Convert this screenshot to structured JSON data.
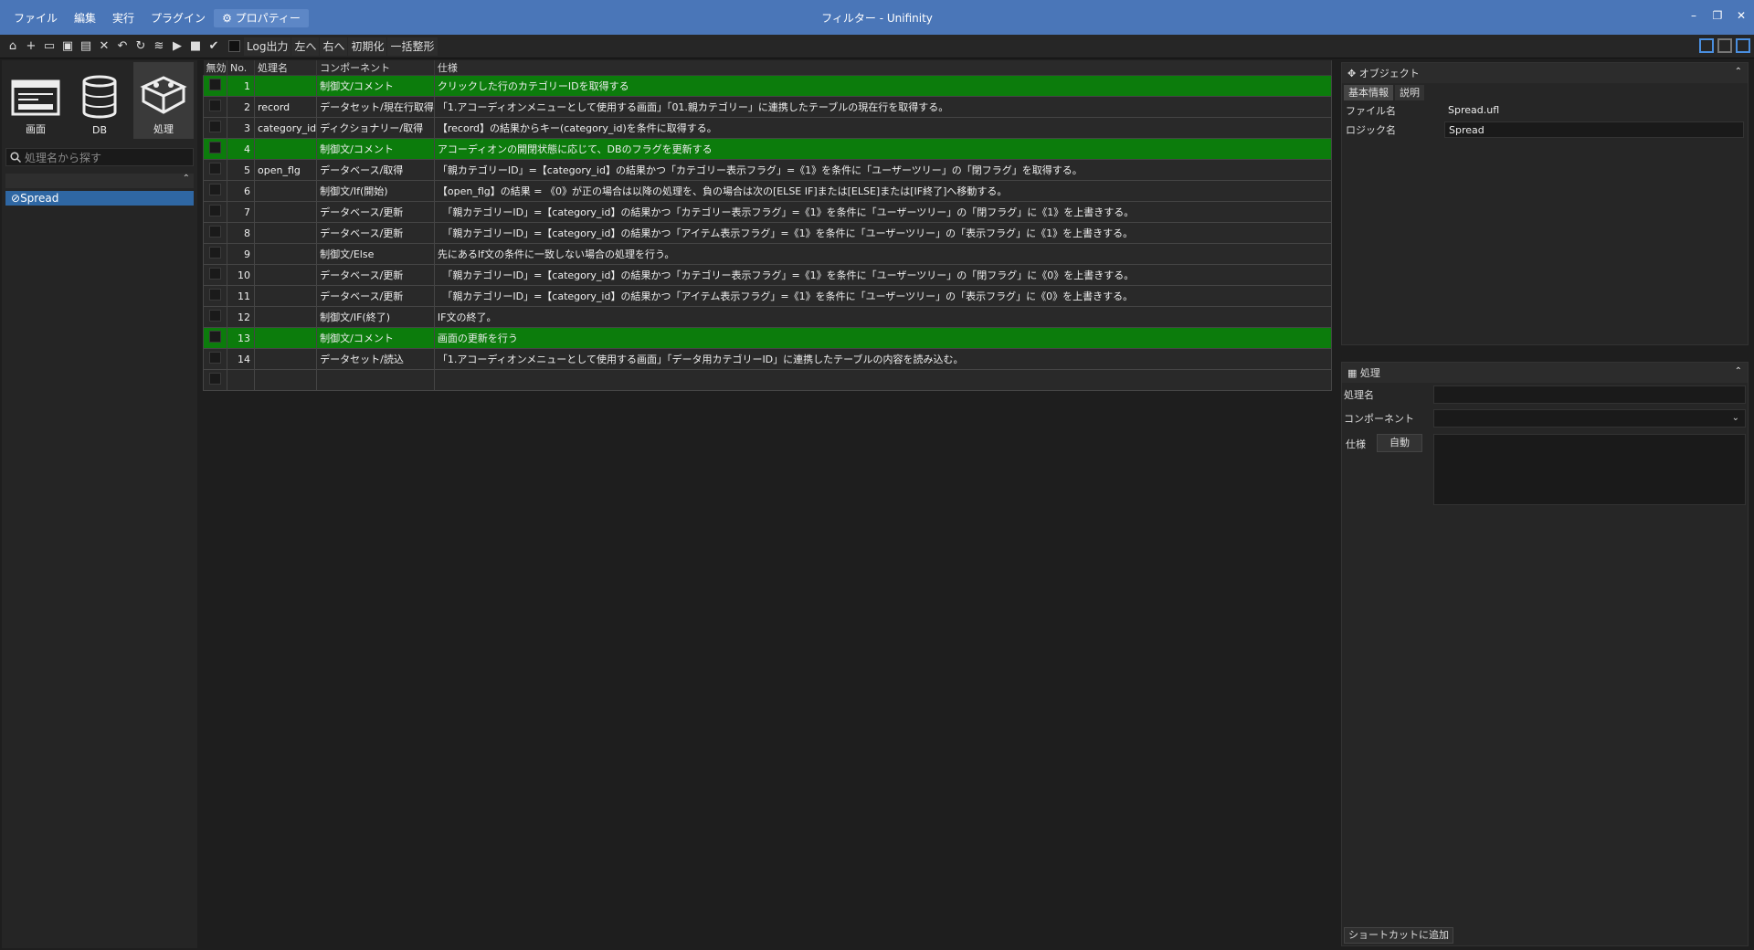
{
  "menu": [
    "ファイル",
    "編集",
    "実行",
    "プラグイン",
    "プロパティー"
  ],
  "window_title": "フィルター - Unifinity",
  "toolbar": {
    "log_label": "Log出力",
    "left_label": "左へ",
    "right_label": "右へ",
    "init_label": "初期化",
    "format_label": "一括整形"
  },
  "sidebar": {
    "buttons": [
      "画面",
      "DB",
      "処理"
    ],
    "search_placeholder": "処理名から探す",
    "tree_item": "Spread"
  },
  "grid": {
    "headers": [
      "無効",
      "No.",
      "処理名",
      "コンポーネント",
      "仕様"
    ],
    "rows": [
      {
        "no": "1",
        "name": "",
        "component": "制御文/コメント",
        "spec": "クリックした行のカテゴリーIDを取得する",
        "green": true
      },
      {
        "no": "2",
        "name": "record",
        "component": "データセット/現在行取得",
        "spec": "「1.アコーディオンメニューとして使用する画面」「01.親カテゴリー」に連携したテーブルの現在行を取得する。",
        "green": false
      },
      {
        "no": "3",
        "name": "category_id",
        "component": "ディクショナリー/取得",
        "spec": "【record】の結果からキー(category_id)を条件に取得する。",
        "green": false
      },
      {
        "no": "4",
        "name": "",
        "component": "制御文/コメント",
        "spec": "アコーディオンの開閉状態に応じて、DBのフラグを更新する",
        "green": true
      },
      {
        "no": "5",
        "name": "open_flg",
        "component": "データベース/取得",
        "spec": "「親カテゴリーID」=【category_id】の結果かつ「カテゴリー表示フラグ」=《1》を条件に「ユーザーツリー」の「閉フラグ」を取得する。",
        "green": false
      },
      {
        "no": "6",
        "name": "",
        "component": "制御文/If(開始)",
        "spec": "【open_flg】の結果 = 《0》が正の場合は以降の処理を、負の場合は次の[ELSE IF]または[ELSE]または[IF終了]へ移動する。",
        "green": false
      },
      {
        "no": "7",
        "name": "",
        "component": "データベース/更新",
        "spec": "　「親カテゴリーID」=【category_id】の結果かつ「カテゴリー表示フラグ」=《1》を条件に「ユーザーツリー」の「閉フラグ」に《1》を上書きする。",
        "green": false
      },
      {
        "no": "8",
        "name": "",
        "component": "データベース/更新",
        "spec": "　「親カテゴリーID」=【category_id】の結果かつ「アイテム表示フラグ」=《1》を条件に「ユーザーツリー」の「表示フラグ」に《1》を上書きする。",
        "green": false
      },
      {
        "no": "9",
        "name": "",
        "component": "制御文/Else",
        "spec": "先にあるIf文の条件に一致しない場合の処理を行う。",
        "green": false
      },
      {
        "no": "10",
        "name": "",
        "component": "データベース/更新",
        "spec": "　「親カテゴリーID」=【category_id】の結果かつ「カテゴリー表示フラグ」=《1》を条件に「ユーザーツリー」の「閉フラグ」に《0》を上書きする。",
        "green": false
      },
      {
        "no": "11",
        "name": "",
        "component": "データベース/更新",
        "spec": "　「親カテゴリーID」=【category_id】の結果かつ「アイテム表示フラグ」=《1》を条件に「ユーザーツリー」の「表示フラグ」に《0》を上書きする。",
        "green": false
      },
      {
        "no": "12",
        "name": "",
        "component": "制御文/IF(終了)",
        "spec": "IF文の終了。",
        "green": false
      },
      {
        "no": "13",
        "name": "",
        "component": "制御文/コメント",
        "spec": "画面の更新を行う",
        "green": true
      },
      {
        "no": "14",
        "name": "",
        "component": "データセット/読込",
        "spec": "「1.アコーディオンメニューとして使用する画面」「データ用カテゴリーID」に連携したテーブルの内容を読み込む。",
        "green": false
      }
    ]
  },
  "object_pane": {
    "title": "オブジェクト",
    "tabs": [
      "基本情報",
      "説明"
    ],
    "file_label": "ファイル名",
    "file_value": "Spread.ufl",
    "logic_label": "ロジック名",
    "logic_value": "Spread"
  },
  "process_pane": {
    "title": "処理",
    "name_label": "処理名",
    "component_label": "コンポーネント",
    "spec_label": "仕様",
    "auto_label": "自動",
    "shortcut_label": "ショートカットに追加"
  }
}
